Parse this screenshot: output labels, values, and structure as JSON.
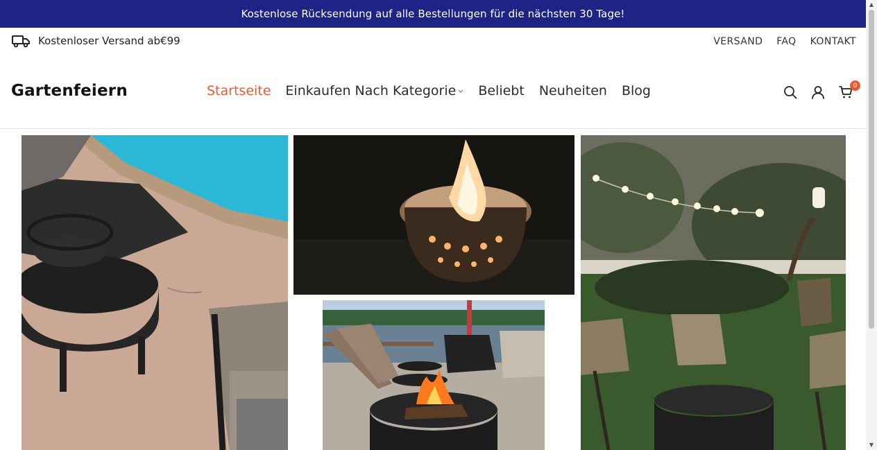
{
  "announcement": "Kostenlose Rücksendung auf alle Bestellungen für die nächsten 30 Tage!",
  "shipping": {
    "icon": "truck-icon",
    "text": "Kostenloser Versand ab€99"
  },
  "top_links": [
    {
      "label": "VERSAND"
    },
    {
      "label": "FAQ"
    },
    {
      "label": "KONTAKT"
    }
  ],
  "logo": "Gartenfeiern",
  "nav": [
    {
      "label": "Startseite",
      "active": true
    },
    {
      "label": "Einkaufen Nach Kategorie",
      "has_dropdown": true
    },
    {
      "label": "Beliebt"
    },
    {
      "label": "Neuheiten"
    },
    {
      "label": "Blog"
    }
  ],
  "header_icons": [
    "search-icon",
    "user-icon",
    "cart-icon"
  ],
  "cart_count": "0",
  "colors": {
    "announcement_bg": "#1d2486",
    "accent": "#ee5a2f"
  },
  "gallery": [
    {
      "name": "poolside-fire-pit-photo"
    },
    {
      "name": "night-fire-pit-flame-photo"
    },
    {
      "name": "lakeside-deck-fire-pit-photo"
    },
    {
      "name": "backyard-string-lights-fire-pit-photo"
    }
  ]
}
